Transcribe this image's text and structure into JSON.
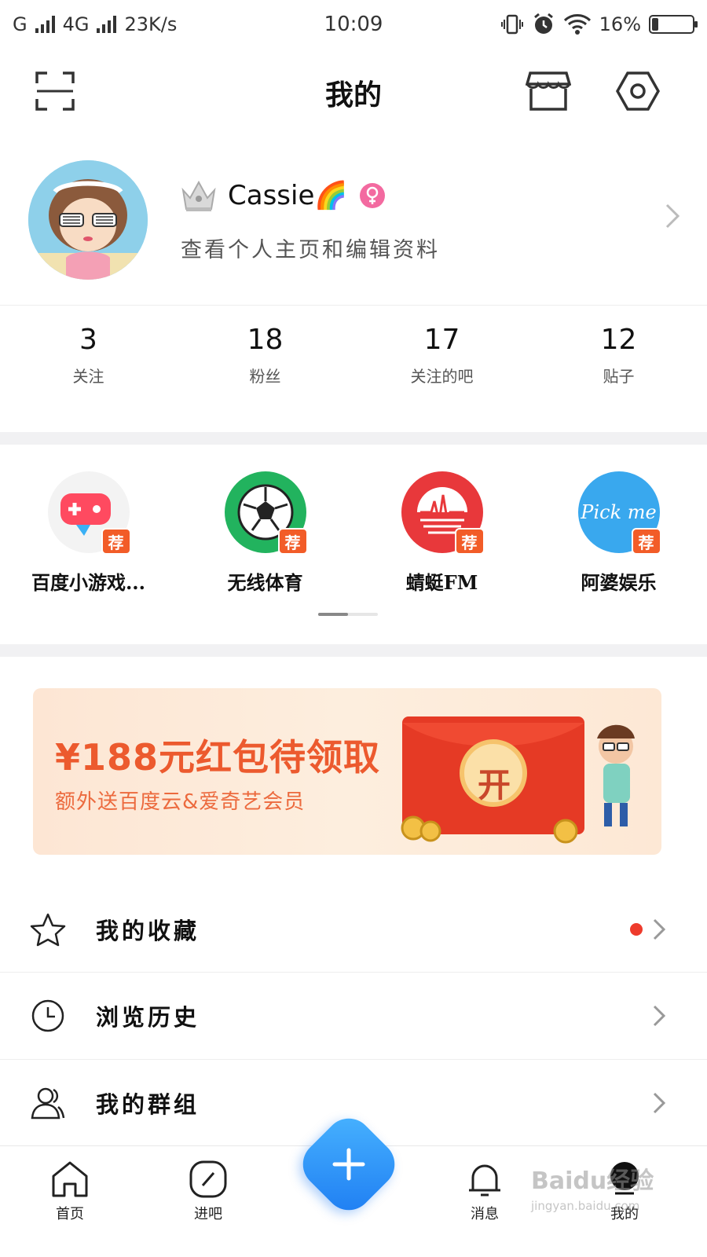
{
  "status_bar": {
    "carrier1": "G",
    "carrier2": "4G",
    "speed": "23K/s",
    "time": "10:09",
    "battery_text": "16%",
    "battery_level": 0.16
  },
  "header": {
    "title": "我的",
    "icons": [
      "scan-icon",
      "store-icon",
      "settings-icon"
    ]
  },
  "profile": {
    "username": "Cassie🌈",
    "subtitle": "查看个人主页和编辑资料",
    "badges": [
      "crown-icon",
      "female-icon"
    ]
  },
  "stats": [
    {
      "value": "3",
      "label": "关注"
    },
    {
      "value": "18",
      "label": "粉丝"
    },
    {
      "value": "17",
      "label": "关注的吧"
    },
    {
      "value": "12",
      "label": "贴子"
    }
  ],
  "apps": [
    {
      "name": "百度小游戏...",
      "badge": "荐",
      "icon": "game-controller-icon",
      "color": "#ff4a60"
    },
    {
      "name": "无线体育",
      "badge": "荐",
      "icon": "soccer-ball-icon",
      "color": "#22b35e"
    },
    {
      "name": "蜻蜓FM",
      "badge": "荐",
      "icon": "radio-icon",
      "color": "#e8383b"
    },
    {
      "name": "阿婆娱乐",
      "badge": "荐",
      "icon": "pickme-icon",
      "color": "#39a8ee",
      "icon_text": "Pick me"
    }
  ],
  "banner": {
    "title": "¥188元红包待领取",
    "subtitle": "额外送百度云&爱奇艺会员",
    "envelope_text": "开"
  },
  "menu": [
    {
      "label": "我的收藏",
      "icon": "star-icon",
      "has_dot": true
    },
    {
      "label": "浏览历史",
      "icon": "clock-icon",
      "has_dot": false
    },
    {
      "label": "我的群组",
      "icon": "group-icon",
      "has_dot": false
    }
  ],
  "bottom_nav": [
    {
      "label": "首页",
      "icon": "home-icon"
    },
    {
      "label": "进吧",
      "icon": "compass-icon"
    },
    {
      "label": "消息",
      "icon": "bell-icon"
    },
    {
      "label": "我的",
      "icon": "profile-icon"
    }
  ],
  "fab": {
    "icon": "plus-icon"
  },
  "watermark": {
    "text": "Baidu经验",
    "sub": "jingyan.baidu.com"
  },
  "colors": {
    "accent_blue": "#2a8cf7",
    "badge_orange": "#f25c28",
    "banner_text": "#ec5a2e",
    "dot_red": "#ee3b2c"
  }
}
